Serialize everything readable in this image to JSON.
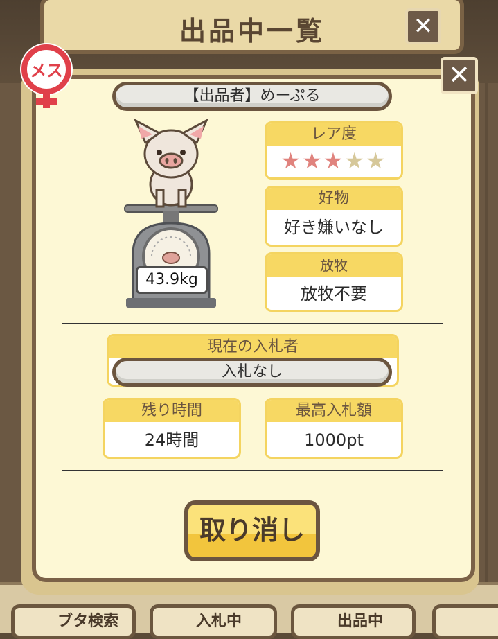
{
  "screen": {
    "title": "出品中一覧",
    "close_icon": "✕"
  },
  "bottom_nav": [
    {
      "label": "ブタ検索"
    },
    {
      "label": "入札中"
    },
    {
      "label": "出品中"
    }
  ],
  "dialog": {
    "close_icon": "✕",
    "gender_badge": "メス",
    "seller": "【出品者】めーぷる",
    "weight": "43.9kg",
    "rarity": {
      "label": "レア度",
      "value": 3,
      "max": 5
    },
    "favorite": {
      "label": "好物",
      "value": "好き嫌いなし"
    },
    "grazing": {
      "label": "放牧",
      "value": "放牧不要"
    },
    "current_bidder": {
      "label": "現在の入札者",
      "value": "入札なし"
    },
    "remaining_time": {
      "label": "残り時間",
      "value": "24時間"
    },
    "highest_bid": {
      "label": "最高入札額",
      "value": "1000pt"
    },
    "cancel_button": "取り消し"
  },
  "colors": {
    "panel_bg": "#fdf8d5",
    "card_header": "#f7d863",
    "border_brown": "#7a6147",
    "star_on": "#e0837e",
    "star_off": "#d6c89a"
  }
}
